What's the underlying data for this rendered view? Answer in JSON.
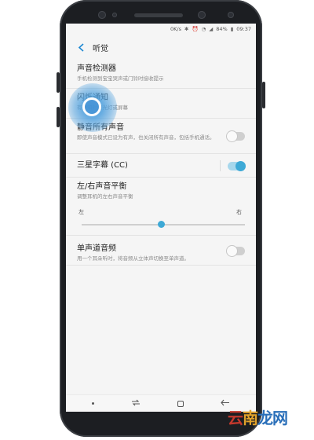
{
  "status_bar": {
    "net_speed": "0K/s",
    "battery": "84%",
    "time": "09:37"
  },
  "header": {
    "title": "听觉"
  },
  "settings": [
    {
      "title": "声音检测器",
      "subtitle": "手机检测到宝宝哭声或门铃时接收提示"
    },
    {
      "title": "闪烁通知",
      "subtitle": "有通知时闪光灯或屏幕"
    },
    {
      "title": "静音所有声音",
      "subtitle": "即使声音模式已设为有声，也关闭所有声音，包括手机通话。",
      "toggle": false
    },
    {
      "title": "三星字幕 (CC)",
      "toggle": true
    },
    {
      "title": "左/右声音平衡",
      "subtitle": "调整耳机的左右声音平衡",
      "left_label": "左",
      "right_label": "右",
      "balance": 0.5
    },
    {
      "title": "单声道音频",
      "subtitle": "用一个耳朵听时，将音频从立体声切换至单声道。",
      "toggle": false
    }
  ],
  "watermark": {
    "part1": "云",
    "part2": "南",
    "part3": "龙网"
  },
  "colors": {
    "accent": "#3ea9d6",
    "back_arrow": "#1e88d2",
    "tap_highlight": "#4fa0de"
  }
}
